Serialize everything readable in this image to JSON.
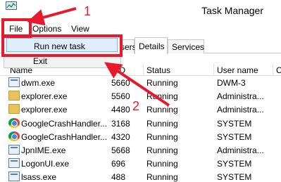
{
  "window": {
    "title": "Task Manager",
    "icon": "task-manager-icon"
  },
  "menu": [
    {
      "label": "File"
    },
    {
      "label": "Options"
    },
    {
      "label": "View"
    }
  ],
  "file_menu": {
    "items": [
      {
        "label": "Run new task",
        "highlighted": true
      },
      {
        "label": "Exit"
      }
    ]
  },
  "tabs": [
    {
      "label": "sers",
      "active": false
    },
    {
      "label": "Details",
      "active": true
    },
    {
      "label": "Services",
      "active": false
    }
  ],
  "columns": {
    "name": "Name",
    "pid": "PID",
    "status": "Status",
    "username": "User name",
    "extra": "C"
  },
  "processes": [
    {
      "icon": "window-icon",
      "name": "dwm.exe",
      "pid": "5660",
      "status": "Running",
      "user": "DWM-3"
    },
    {
      "icon": "folder-icon",
      "name": "explorer.exe",
      "pid": "5560",
      "status": "Running",
      "user": "Administra..."
    },
    {
      "icon": "folder-icon",
      "name": "explorer.exe",
      "pid": "4480",
      "status": "Running",
      "user": "Administra..."
    },
    {
      "icon": "chrome-icon",
      "name": "GoogleCrashHandler....",
      "pid": "3168",
      "status": "Running",
      "user": "SYSTEM"
    },
    {
      "icon": "chrome-icon",
      "name": "GoogleCrashHandler....",
      "pid": "4320",
      "status": "Running",
      "user": "SYSTEM"
    },
    {
      "icon": "window-icon",
      "name": "JpnIME.exe",
      "pid": "5668",
      "status": "Running",
      "user": "Administra..."
    },
    {
      "icon": "window-icon",
      "name": "LogonUI.exe",
      "pid": "696",
      "status": "Running",
      "user": "SYSTEM"
    },
    {
      "icon": "window-icon",
      "name": "lsass.exe",
      "pid": "488",
      "status": "Running",
      "user": "SYSTEM"
    }
  ],
  "annotations": {
    "step1": "1",
    "step2": "2",
    "color": "#e8192c"
  }
}
